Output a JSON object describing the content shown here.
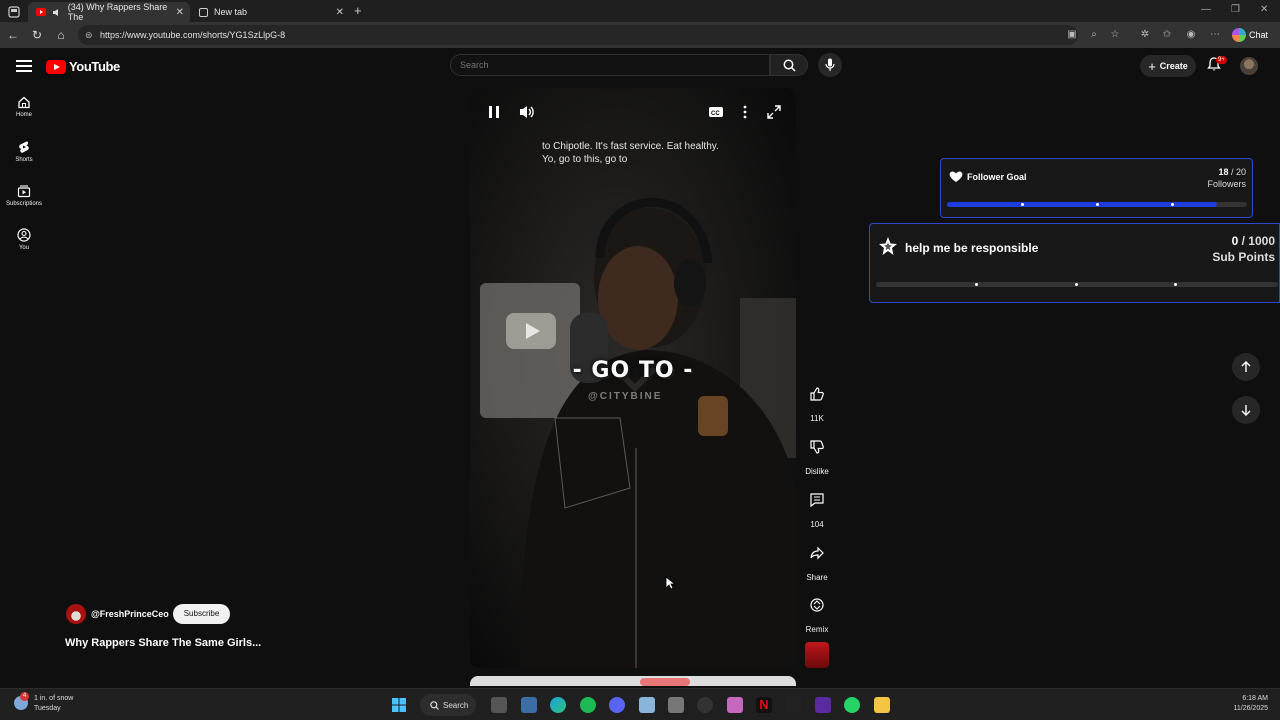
{
  "browser": {
    "tabs": [
      {
        "label": "(34) Why Rappers Share The",
        "active": true
      },
      {
        "label": "New tab",
        "active": false
      }
    ],
    "url": "https://www.youtube.com/shorts/YG1SzLlpG-8",
    "chat_label": "Chat"
  },
  "header": {
    "logo_text": "YouTube",
    "search_placeholder": "Search",
    "create_label": "Create",
    "notification_count": "9+"
  },
  "rail": [
    {
      "label": "Home",
      "icon": "home-icon"
    },
    {
      "label": "Shorts",
      "icon": "shorts-icon"
    },
    {
      "label": "Subscriptions",
      "icon": "subscriptions-icon"
    },
    {
      "label": "You",
      "icon": "you-icon"
    }
  ],
  "video": {
    "caption": "to Chipotle. It's fast service. Eat healthy. Yo, go to this, go to",
    "overlay_text": "- GO TO -",
    "watermark": "@CITYBINE"
  },
  "actions": {
    "like_count": "11K",
    "dislike_label": "Dislike",
    "comment_count": "104",
    "share_label": "Share",
    "remix_label": "Remix"
  },
  "channel": {
    "handle": "@FreshPrinceCeo",
    "subscribe_label": "Subscribe",
    "title": "Why Rappers Share The Same Girls..."
  },
  "follower_goal": {
    "title": "Follower Goal",
    "current": "18",
    "separator": " / 20",
    "unit": "Followers",
    "progress": 0.9,
    "color": "#1e3ce0"
  },
  "sub_goal": {
    "title": "help me be responsible",
    "current": "0",
    "separator": " / 1000",
    "unit": "Sub Points",
    "progress": 0.0
  },
  "taskbar": {
    "weather_line1": "1 in. of snow",
    "weather_line2": "Tuesday",
    "weather_alert": "4",
    "search_label": "Search",
    "time": "6:18 AM",
    "date": "11/26/2025"
  }
}
